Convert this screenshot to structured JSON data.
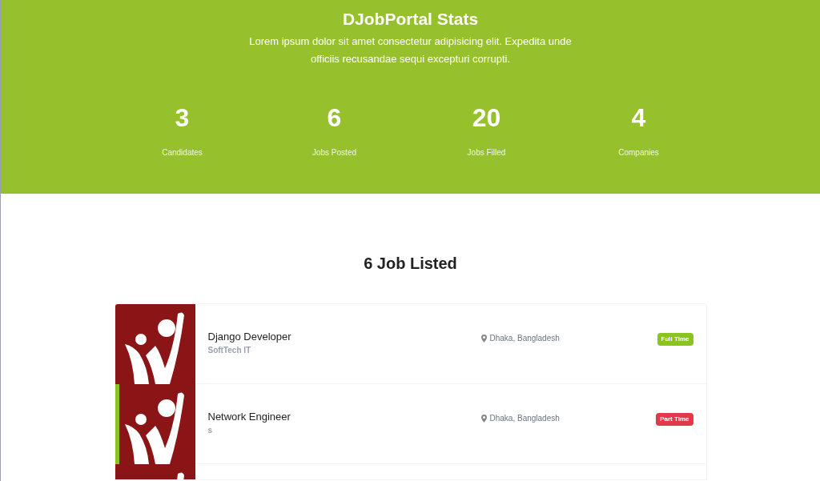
{
  "stats_section": {
    "title": "DJobPortal Stats",
    "description": "Lorem ipsum dolor sit amet consectetur adipisicing elit. Expedita unde officiis recusandae sequi excepturi corrupti.",
    "stats": [
      {
        "value": "3",
        "label": "Candidates"
      },
      {
        "value": "6",
        "label": "Jobs Posted"
      },
      {
        "value": "20",
        "label": "Jobs Filled"
      },
      {
        "value": "4",
        "label": "Companies"
      }
    ]
  },
  "jobs_section": {
    "title": "6 Job Listed",
    "jobs": [
      {
        "title": "Django Developer",
        "company": "SoftTech IT",
        "location": "Dhaka, Bangladesh",
        "type": {
          "kind": "full_time",
          "label": "Full Time"
        },
        "selected": false
      },
      {
        "title": "Network Engineer",
        "company": "s",
        "location": "Dhaka, Bangladesh",
        "type": {
          "kind": "part_time",
          "label": "Part Time"
        },
        "selected": true
      },
      {
        "selected": false
      }
    ]
  }
}
